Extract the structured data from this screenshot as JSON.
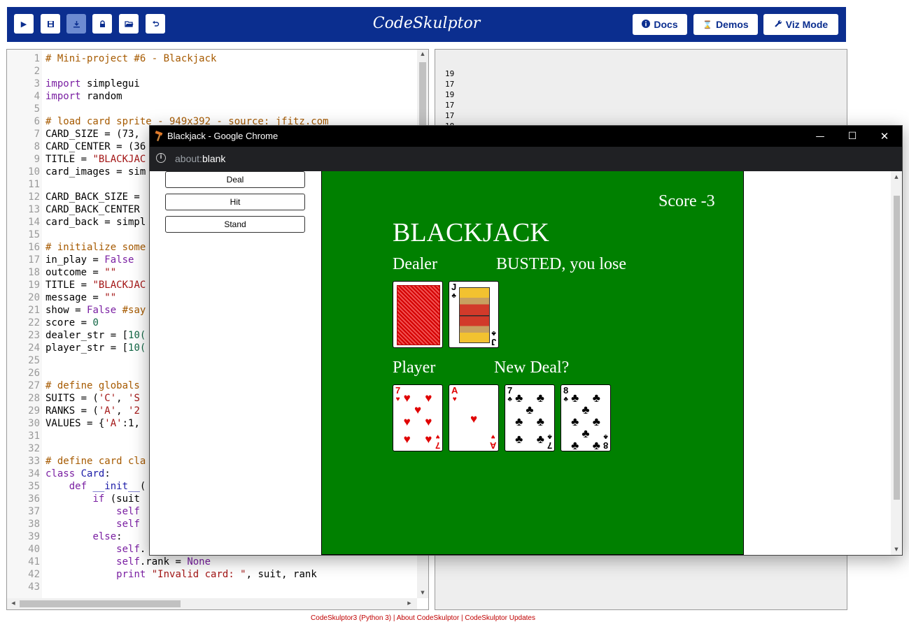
{
  "toolbar": {
    "brand": "CodeSkulptor",
    "icons": [
      "play-icon",
      "save-icon",
      "download-icon",
      "lock-icon",
      "folder-open-icon",
      "undo-icon"
    ],
    "docs_label": "Docs",
    "demos_label": "Demos",
    "viz_label": "Viz Mode"
  },
  "editor": {
    "lines": [
      {
        "n": "1",
        "parts": [
          [
            "cm",
            "# Mini-project #6 - Blackjack"
          ]
        ]
      },
      {
        "n": "2",
        "parts": []
      },
      {
        "n": "3",
        "parts": [
          [
            "kw",
            "import"
          ],
          [
            "pl",
            " simplegui"
          ]
        ]
      },
      {
        "n": "4",
        "parts": [
          [
            "kw",
            "import"
          ],
          [
            "pl",
            " random"
          ]
        ]
      },
      {
        "n": "5",
        "parts": []
      },
      {
        "n": "6",
        "parts": [
          [
            "cm",
            "# load card sprite - 949x392 - source: jfitz.com"
          ]
        ]
      },
      {
        "n": "7",
        "parts": [
          [
            "pl",
            "CARD_SIZE = (73, "
          ]
        ]
      },
      {
        "n": "8",
        "parts": [
          [
            "pl",
            "CARD_CENTER = (36"
          ]
        ]
      },
      {
        "n": "9",
        "parts": [
          [
            "pl",
            "TITLE = "
          ],
          [
            "st",
            "\"BLACKJAC"
          ]
        ]
      },
      {
        "n": "10",
        "parts": [
          [
            "pl",
            "card_images = sim"
          ]
        ]
      },
      {
        "n": "11",
        "parts": []
      },
      {
        "n": "12",
        "parts": [
          [
            "pl",
            "CARD_BACK_SIZE = "
          ]
        ]
      },
      {
        "n": "13",
        "parts": [
          [
            "pl",
            "CARD_BACK_CENTER "
          ]
        ]
      },
      {
        "n": "14",
        "parts": [
          [
            "pl",
            "card_back = simpl"
          ]
        ]
      },
      {
        "n": "15",
        "parts": []
      },
      {
        "n": "16",
        "parts": [
          [
            "cm",
            "# initialize some"
          ]
        ]
      },
      {
        "n": "17",
        "parts": [
          [
            "pl",
            "in_play = "
          ],
          [
            "kw",
            "False"
          ]
        ]
      },
      {
        "n": "18",
        "parts": [
          [
            "pl",
            "outcome = "
          ],
          [
            "st",
            "\"\""
          ]
        ]
      },
      {
        "n": "19",
        "parts": [
          [
            "pl",
            "TITLE = "
          ],
          [
            "st",
            "\"BLACKJAC"
          ]
        ]
      },
      {
        "n": "20",
        "parts": [
          [
            "pl",
            "message = "
          ],
          [
            "st",
            "\"\""
          ]
        ]
      },
      {
        "n": "21",
        "parts": [
          [
            "pl",
            "show = "
          ],
          [
            "kw",
            "False"
          ],
          [
            "cm",
            " #say"
          ]
        ]
      },
      {
        "n": "22",
        "parts": [
          [
            "pl",
            "score = "
          ],
          [
            "nm",
            "0"
          ]
        ]
      },
      {
        "n": "23",
        "parts": [
          [
            "pl",
            "dealer_str = ["
          ],
          [
            "nm",
            "10("
          ]
        ]
      },
      {
        "n": "24",
        "parts": [
          [
            "pl",
            "player_str = ["
          ],
          [
            "nm",
            "10("
          ]
        ]
      },
      {
        "n": "25",
        "parts": []
      },
      {
        "n": "26",
        "parts": []
      },
      {
        "n": "27",
        "parts": [
          [
            "cm",
            "# define globals "
          ]
        ]
      },
      {
        "n": "28",
        "parts": [
          [
            "pl",
            "SUITS = ("
          ],
          [
            "st",
            "'C'"
          ],
          [
            "pl",
            ", "
          ],
          [
            "st",
            "'S"
          ]
        ]
      },
      {
        "n": "29",
        "parts": [
          [
            "pl",
            "RANKS = ("
          ],
          [
            "st",
            "'A'"
          ],
          [
            "pl",
            ", "
          ],
          [
            "st",
            "'2"
          ]
        ]
      },
      {
        "n": "30",
        "parts": [
          [
            "pl",
            "VALUES = {"
          ],
          [
            "st",
            "'A'"
          ],
          [
            "pl",
            ":1, "
          ]
        ]
      },
      {
        "n": "31",
        "parts": []
      },
      {
        "n": "32",
        "parts": []
      },
      {
        "n": "33",
        "parts": [
          [
            "cm",
            "# define card cla"
          ]
        ]
      },
      {
        "n": "34",
        "parts": [
          [
            "kw",
            "class"
          ],
          [
            "pl",
            " "
          ],
          [
            "kwb",
            "Card"
          ],
          [
            "pl",
            ":"
          ]
        ]
      },
      {
        "n": "35",
        "parts": [
          [
            "pl",
            "    "
          ],
          [
            "kw",
            "def"
          ],
          [
            "pl",
            " "
          ],
          [
            "kwb",
            "__init__"
          ],
          [
            "pl",
            "("
          ]
        ]
      },
      {
        "n": "36",
        "parts": [
          [
            "pl",
            "        "
          ],
          [
            "kw",
            "if"
          ],
          [
            "pl",
            " (suit"
          ]
        ]
      },
      {
        "n": "37",
        "parts": [
          [
            "pl",
            "            "
          ],
          [
            "kw",
            "self"
          ]
        ]
      },
      {
        "n": "38",
        "parts": [
          [
            "pl",
            "            "
          ],
          [
            "kw",
            "self"
          ]
        ]
      },
      {
        "n": "39",
        "parts": [
          [
            "pl",
            "        "
          ],
          [
            "kw",
            "else"
          ],
          [
            "pl",
            ":"
          ]
        ]
      },
      {
        "n": "40",
        "parts": [
          [
            "pl",
            "            "
          ],
          [
            "kw",
            "self"
          ],
          [
            "pl",
            "."
          ]
        ]
      },
      {
        "n": "41",
        "parts": [
          [
            "pl",
            "            "
          ],
          [
            "kw",
            "self"
          ],
          [
            "pl",
            ".rank = "
          ],
          [
            "kw",
            "None"
          ]
        ]
      },
      {
        "n": "42",
        "parts": [
          [
            "pl",
            "            "
          ],
          [
            "kw",
            "print"
          ],
          [
            "pl",
            " "
          ],
          [
            "st",
            "\"Invalid card: \""
          ],
          [
            "pl",
            ", suit, rank"
          ]
        ]
      },
      {
        "n": "43",
        "parts": []
      }
    ]
  },
  "output": {
    "lines": [
      "19",
      "17",
      "19",
      "17",
      "17",
      "18"
    ]
  },
  "footer": {
    "text": "CodeSkulptor3 (Python 3) | About CodeSkulptor | CodeSkulptor Updates"
  },
  "chrome": {
    "title": "Blackjack - Google Chrome",
    "url_scheme": "about:",
    "url_host": "blank",
    "minimize": "—",
    "maximize": "☐",
    "close": "✕"
  },
  "controls": {
    "deal": "Deal",
    "hit": "Hit",
    "stand": "Stand"
  },
  "game": {
    "score": "Score  -3",
    "title": "BLACKJACK",
    "dealer_label": "Dealer",
    "outcome": "BUSTED, you lose",
    "player_label": "Player",
    "message": "New Deal?",
    "dealer_cards": [
      {
        "rank": "",
        "suit": "back"
      },
      {
        "rank": "J",
        "suit": "C"
      }
    ],
    "player_cards": [
      {
        "rank": "7",
        "suit": "H"
      },
      {
        "rank": "A",
        "suit": "H"
      },
      {
        "rank": "7",
        "suit": "C"
      },
      {
        "rank": "8",
        "suit": "C"
      }
    ],
    "colors": {
      "table": "#008000",
      "red_suit": "#e00000",
      "black_suit": "#000000"
    }
  }
}
